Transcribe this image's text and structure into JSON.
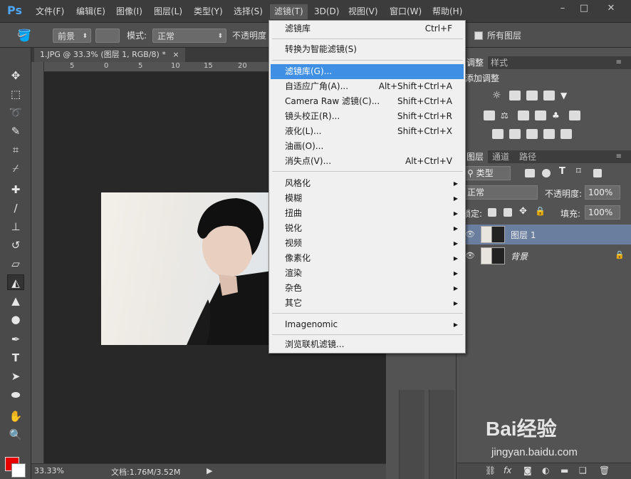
{
  "app": {
    "logo": "Ps"
  },
  "menubar": {
    "items": [
      "文件(F)",
      "编辑(E)",
      "图像(I)",
      "图层(L)",
      "类型(Y)",
      "选择(S)",
      "滤镜(T)",
      "3D(D)",
      "视图(V)",
      "窗口(W)",
      "帮助(H)"
    ],
    "active": "滤镜(T)"
  },
  "window_controls": {
    "minimize": "–",
    "restore": "□",
    "close": "✕"
  },
  "options_bar": {
    "fill_source": "前景",
    "mode_label": "模式:",
    "mode_value": "正常",
    "opacity_label": "不透明度",
    "all_layers_label": "所有图层"
  },
  "document": {
    "tab_title": "1.JPG @ 33.3% (图层 1, RGB/8) *",
    "tab_close": "×",
    "ruler_ticks": [
      "5",
      "0",
      "5",
      "10",
      "15",
      "20"
    ]
  },
  "status": {
    "zoom": "33.33%",
    "doc_info": "文档:1.76M/3.52M",
    "arrow": "▶"
  },
  "filter_menu": {
    "items": [
      {
        "label": "滤镜库",
        "shortcut": "Ctrl+F"
      },
      {
        "label": "转换为智能滤镜(S)"
      },
      {
        "label": "滤镜库(G)...",
        "highlighted": true
      },
      {
        "label": "自适应广角(A)...",
        "shortcut": "Alt+Shift+Ctrl+A"
      },
      {
        "label": "Camera Raw 滤镜(C)...",
        "shortcut": "Shift+Ctrl+A"
      },
      {
        "label": "镜头校正(R)...",
        "shortcut": "Shift+Ctrl+R"
      },
      {
        "label": "液化(L)...",
        "shortcut": "Shift+Ctrl+X"
      },
      {
        "label": "油画(O)..."
      },
      {
        "label": "消失点(V)...",
        "shortcut": "Alt+Ctrl+V"
      },
      {
        "label": "风格化",
        "submenu": true
      },
      {
        "label": "模糊",
        "submenu": true
      },
      {
        "label": "扭曲",
        "submenu": true
      },
      {
        "label": "锐化",
        "submenu": true
      },
      {
        "label": "视频",
        "submenu": true
      },
      {
        "label": "像素化",
        "submenu": true
      },
      {
        "label": "渲染",
        "submenu": true
      },
      {
        "label": "杂色",
        "submenu": true
      },
      {
        "label": "其它",
        "submenu": true
      },
      {
        "label": "Imagenomic",
        "submenu": true
      },
      {
        "label": "浏览联机滤镜..."
      }
    ]
  },
  "adjustments_panel": {
    "tabs": [
      "调整",
      "样式"
    ],
    "title": "添加调整"
  },
  "layers_panel": {
    "tabs": [
      "图层",
      "通道",
      "路径"
    ],
    "kind_label": "类型",
    "blend_mode": "正常",
    "opacity_label": "不透明度:",
    "opacity_value": "100%",
    "lock_label": "锁定:",
    "fill_label": "填充:",
    "fill_value": "100%",
    "layers": [
      {
        "name": "图层 1",
        "selected": true
      },
      {
        "name": "背景",
        "locked": true
      }
    ]
  },
  "watermark": {
    "brand": "Bai经验",
    "url": "jingyan.baidu.com"
  },
  "colors": {
    "foreground": "#e60000",
    "background": "#ffffff",
    "highlight": "#3f8fe4"
  }
}
